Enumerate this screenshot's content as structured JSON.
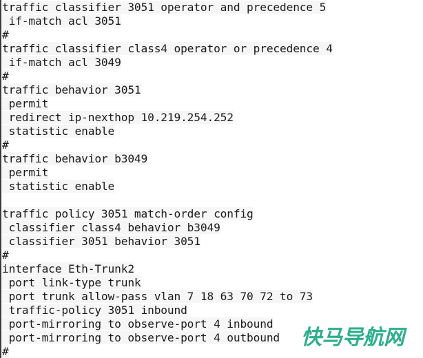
{
  "terminal": {
    "background_color": "#ffffff",
    "text_color": "#1a1a1a",
    "text_run_tint": "#f6f6f6",
    "left_border_color": "#3b3b3b",
    "lines": [
      "traffic classifier 3051 operator and precedence 5",
      " if-match acl 3051",
      "#",
      "traffic classifier class4 operator or precedence 4",
      " if-match acl 3049",
      "#",
      "traffic behavior 3051",
      " permit",
      " redirect ip-nexthop 10.219.254.252",
      " statistic enable",
      "#",
      "traffic behavior b3049",
      " permit",
      " statistic enable",
      "",
      "traffic policy 3051 match-order config",
      " classifier class4 behavior b3049",
      " classifier 3051 behavior 3051",
      "#",
      "interface Eth-Trunk2",
      " port link-type trunk",
      " port trunk allow-pass vlan 7 18 63 70 72 to 73",
      " traffic-policy 3051 inbound",
      " port-mirroring to observe-port 4 inbound",
      " port-mirroring to observe-port 4 outbound",
      "#"
    ]
  },
  "watermark": {
    "text": "快马导航网",
    "color": "#2eae8e",
    "outline_color": "#ffffff"
  }
}
